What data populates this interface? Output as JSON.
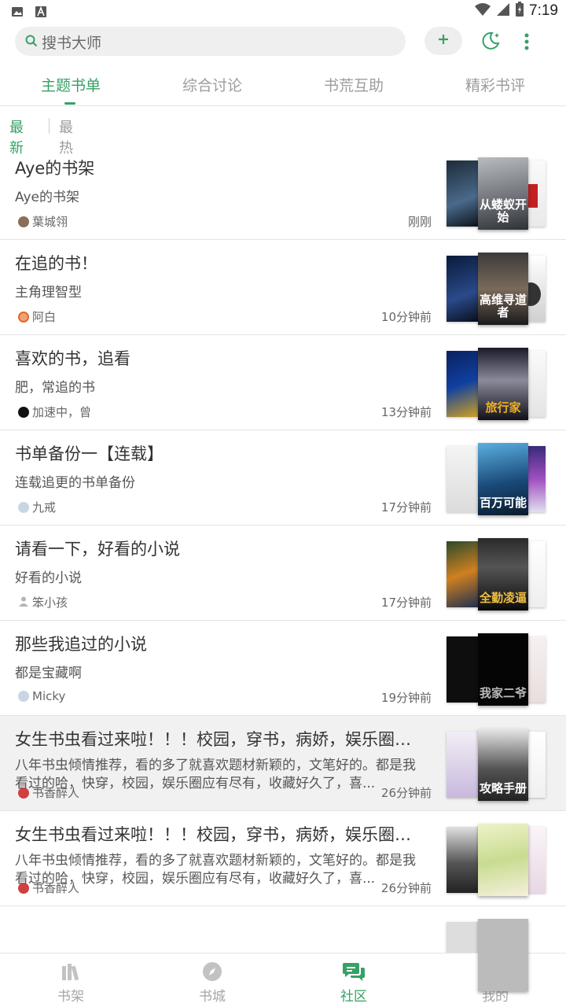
{
  "status": {
    "time": "7:19"
  },
  "search": {
    "placeholder": "搜书大师"
  },
  "tabs": [
    {
      "label": "主题书单",
      "active": true
    },
    {
      "label": "综合讨论",
      "active": false
    },
    {
      "label": "书荒互助",
      "active": false
    },
    {
      "label": "精彩书评",
      "active": false
    }
  ],
  "sort": {
    "latest": "最新",
    "hottest": "最热",
    "selected": "最新"
  },
  "colors": {
    "accent": "#35a165",
    "text": "#333333",
    "muted": "#9c9c9c"
  },
  "booklists": [
    {
      "title": "Aye的书架",
      "desc": "Aye的书架",
      "author": "葉城翎",
      "time": "刚刚",
      "front_cover_text": "从蝼蚁开始"
    },
    {
      "title": "在追的书！",
      "desc": "主角理智型",
      "author": "阿白",
      "time": "10分钟前",
      "front_cover_text": "高维寻道者"
    },
    {
      "title": "喜欢的书，追看",
      "desc": "肥，常追的书",
      "author": "加速中，曾",
      "time": "13分钟前",
      "front_cover_text": "旅行家"
    },
    {
      "title": "书单备份一【连载】",
      "desc": "连载追更的书单备份",
      "author": "九戒",
      "time": "17分钟前",
      "front_cover_text": "百万可能"
    },
    {
      "title": "请看一下，好看的小说",
      "desc": "好看的小说",
      "author": "笨小孩",
      "time": "17分钟前",
      "front_cover_text": "全勤凌逼"
    },
    {
      "title": "那些我追过的小说",
      "desc": "都是宝藏啊",
      "author": "Micky",
      "time": "19分钟前",
      "front_cover_text": "我家二爷"
    },
    {
      "title": "女生书虫看过来啦！！！校园，穿书，病娇，娱乐圈瞅...",
      "desc": "八年书虫倾情推荐，看的多了就喜欢题材新颖的，文笔好的。都是我看过的哈，快穿，校园，娱乐圈应有尽有，收藏好久了，喜...",
      "author": "书香醉人",
      "time": "26分钟前",
      "front_cover_text": "攻略手册"
    },
    {
      "title": "女生书虫看过来啦！！！校园，穿书，病娇，娱乐圈瞅...",
      "desc": "八年书虫倾情推荐，看的多了就喜欢题材新颖的，文笔好的。都是我看过的哈，快穿，校园，娱乐圈应有尽有，收藏好久了，喜...",
      "author": "书香醉人",
      "time": "26分钟前",
      "front_cover_text": ""
    }
  ],
  "bottom_nav": [
    {
      "label": "书架",
      "icon": "bookshelf-icon",
      "active": false
    },
    {
      "label": "书城",
      "icon": "compass-icon",
      "active": false
    },
    {
      "label": "社区",
      "icon": "chat-icon",
      "active": true
    },
    {
      "label": "我的",
      "icon": "profile-icon",
      "active": false
    }
  ]
}
